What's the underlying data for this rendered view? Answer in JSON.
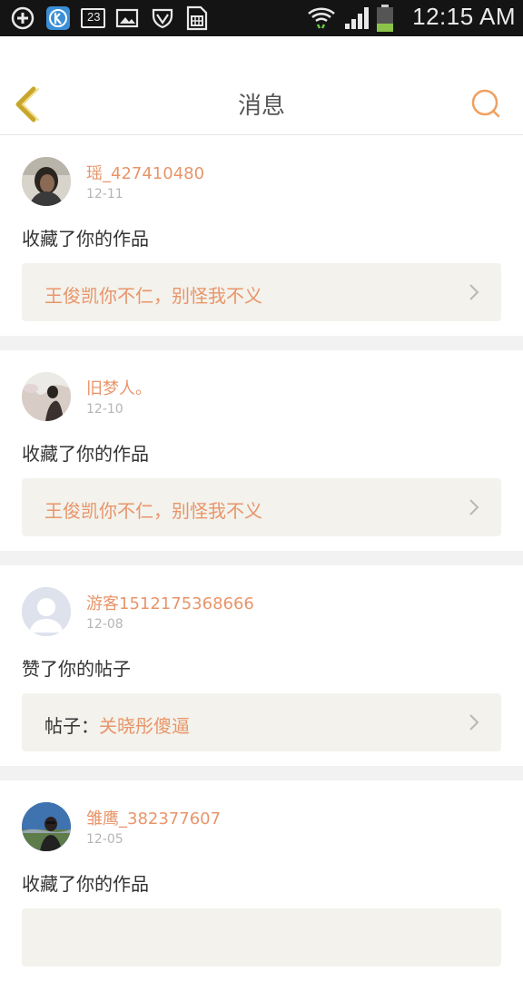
{
  "status_bar": {
    "time": "12:15 AM",
    "notification_count": "23",
    "icons": [
      "add-circle-icon",
      "k-app-icon",
      "notification-count-icon",
      "image-icon",
      "shield-icon",
      "sim-card-icon",
      "wifi-icon",
      "signal-icon",
      "battery-icon"
    ],
    "battery_level": 0.3
  },
  "header": {
    "title": "消息",
    "back_icon": "chevron-left-icon",
    "search_icon": "search-icon",
    "accent_color": "#f0a060"
  },
  "messages": [
    {
      "username": "瑶_427410480",
      "date": "12-11",
      "action": "收藏了你的作品",
      "ref_prefix": "",
      "ref_title": "王俊凯你不仁，别怪我不义"
    },
    {
      "username": "旧梦人。",
      "date": "12-10",
      "action": "收藏了你的作品",
      "ref_prefix": "",
      "ref_title": "王俊凯你不仁，别怪我不义"
    },
    {
      "username": "游客1512175368666",
      "date": "12-08",
      "action": "赞了你的帖子",
      "ref_prefix": "帖子：",
      "ref_title": "关晓彤傻逼"
    },
    {
      "username": "雏鹰_382377607",
      "date": "12-05",
      "action": "收藏了你的作品",
      "ref_prefix": "",
      "ref_title": ""
    }
  ],
  "colors": {
    "username": "#e8956a",
    "ref_box": "#f3f2ec",
    "divider": "#f2f2f2"
  }
}
